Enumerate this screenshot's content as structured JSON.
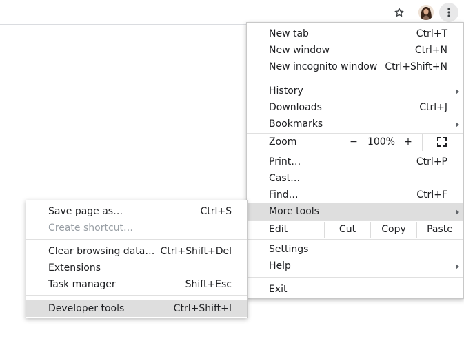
{
  "toolbar": {
    "star_icon": "star-icon",
    "avatar_icon": "profile-avatar",
    "menu_icon": "three-dot-menu-icon"
  },
  "main_menu": {
    "new_tab": {
      "label": "New tab",
      "shortcut": "Ctrl+T"
    },
    "new_window": {
      "label": "New window",
      "shortcut": "Ctrl+N"
    },
    "new_incognito": {
      "label": "New incognito window",
      "shortcut": "Ctrl+Shift+N"
    },
    "history": {
      "label": "History"
    },
    "downloads": {
      "label": "Downloads",
      "shortcut": "Ctrl+J"
    },
    "bookmarks": {
      "label": "Bookmarks"
    },
    "zoom": {
      "label": "Zoom",
      "minus": "−",
      "value": "100%",
      "plus": "+"
    },
    "print": {
      "label": "Print…",
      "shortcut": "Ctrl+P"
    },
    "cast": {
      "label": "Cast…"
    },
    "find": {
      "label": "Find…",
      "shortcut": "Ctrl+F"
    },
    "more_tools": {
      "label": "More tools"
    },
    "edit": {
      "label": "Edit",
      "cut": "Cut",
      "copy": "Copy",
      "paste": "Paste"
    },
    "settings": {
      "label": "Settings"
    },
    "help": {
      "label": "Help"
    },
    "exit": {
      "label": "Exit"
    }
  },
  "sub_menu": {
    "save_page": {
      "label": "Save page as…",
      "shortcut": "Ctrl+S"
    },
    "create_shortcut": {
      "label": "Create shortcut…"
    },
    "clear_browsing": {
      "label": "Clear browsing data…",
      "shortcut": "Ctrl+Shift+Del"
    },
    "extensions": {
      "label": "Extensions"
    },
    "task_manager": {
      "label": "Task manager",
      "shortcut": "Shift+Esc"
    },
    "developer_tools": {
      "label": "Developer tools",
      "shortcut": "Ctrl+Shift+I"
    }
  }
}
